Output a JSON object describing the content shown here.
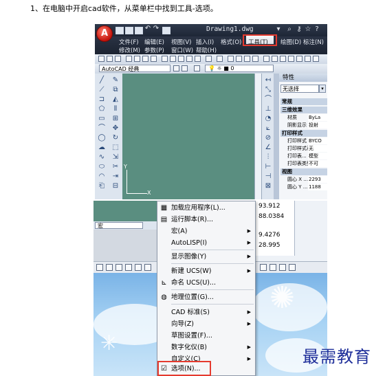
{
  "caption": "1、在电脑中开启cad软件，从菜单栏中找到工具-选项。",
  "cad_window": {
    "title": "Drawing1.dwg",
    "menu_row1": [
      "文件(F)",
      "编辑(E)",
      "视图(V)",
      "插入(I)",
      "格式(O)",
      "工具(T)",
      "绘图(D)",
      "标注(N)"
    ],
    "menu_row2": [
      "修改(M)",
      "参数(P)",
      "窗口(W)",
      "帮助(H)"
    ],
    "workspace_select": "AutoCAD 经典",
    "layer_value": "0",
    "properties": {
      "title": "特性",
      "selection": "无选择",
      "sections": {
        "general": "常规",
        "3d": "三维效果",
        "plot": "打印样式",
        "view": "视图"
      },
      "rows_3d": [
        {
          "key": "材质",
          "value": "ByLa"
        },
        {
          "key": "阴影显示",
          "value": "投射"
        }
      ],
      "rows_plot": [
        {
          "key": "打印样式",
          "value": "BYCO"
        },
        {
          "key": "打印样式表",
          "value": "无"
        },
        {
          "key": "打印表...",
          "value": "模型"
        },
        {
          "key": "打印表类型",
          "value": "不可"
        }
      ],
      "rows_view": [
        {
          "key": "圆心 X ...",
          "value": "2293"
        },
        {
          "key": "圆心 Y ...",
          "value": "1188"
        }
      ]
    },
    "axis_y": "Y",
    "axis_x": "X"
  },
  "tools_menu": {
    "ws_select": "宏",
    "side_values": [
      "93.912",
      "88.0384",
      "9.4276",
      "28.995"
    ],
    "items": [
      {
        "label": "加载应用程序(L)...",
        "icon": "app-load-icon",
        "arrow": false
      },
      {
        "label": "运行脚本(R)...",
        "icon": "script-icon",
        "arrow": false
      },
      {
        "label": "宏(A)",
        "icon": "",
        "arrow": true
      },
      {
        "label": "AutoLISP(I)",
        "icon": "",
        "arrow": true
      },
      {
        "label": "显示图像(Y)",
        "icon": "",
        "arrow": true
      },
      {
        "label": "新建 UCS(W)",
        "icon": "",
        "arrow": true
      },
      {
        "label": "命名 UCS(U)...",
        "icon": "ucs-icon",
        "arrow": false
      },
      {
        "label": "地理位置(G)...",
        "icon": "globe-icon",
        "arrow": false
      },
      {
        "label": "CAD 标准(S)",
        "icon": "",
        "arrow": true
      },
      {
        "label": "向导(Z)",
        "icon": "",
        "arrow": true
      },
      {
        "label": "草图设置(F)...",
        "icon": "",
        "arrow": false
      },
      {
        "label": "数字化仪(B)",
        "icon": "",
        "arrow": true
      },
      {
        "label": "自定义(C)",
        "icon": "",
        "arrow": true
      },
      {
        "label": "选项(N)...",
        "icon": "checkbox-icon",
        "arrow": false
      }
    ]
  },
  "watermark": "最需教育",
  "colors": {
    "highlight": "#e53a2e",
    "drawing_area": "#5a8e80",
    "watermark": "#1f2f9a"
  }
}
